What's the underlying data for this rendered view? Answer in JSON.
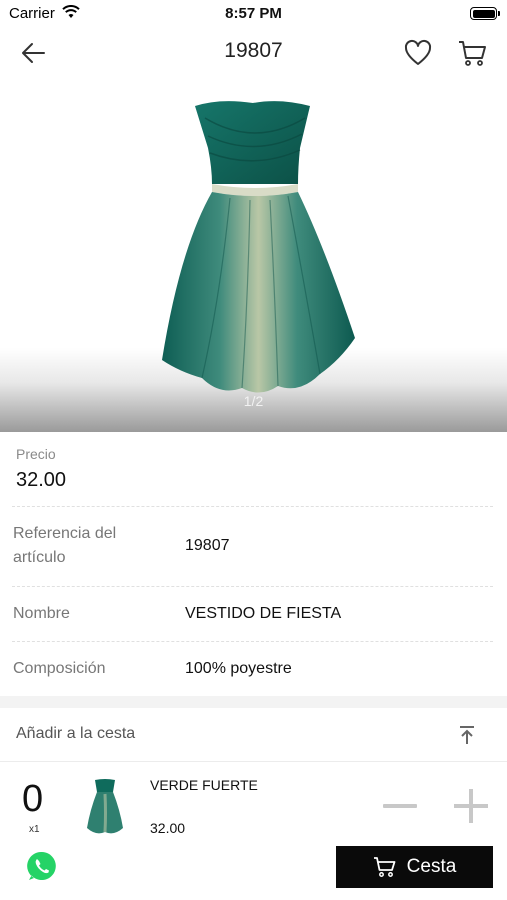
{
  "status_bar": {
    "carrier": "Carrier",
    "time": "8:57 PM"
  },
  "nav": {
    "title": "19807"
  },
  "gallery": {
    "pager": "1/2"
  },
  "details": {
    "price_label": "Precio",
    "price_value": "32.00",
    "rows": [
      {
        "label": "Referencia del artículo",
        "value": "19807"
      },
      {
        "label": "Nombre",
        "value": "VESTIDO DE  FIESTA"
      },
      {
        "label": "Composición",
        "value": "100% poyestre"
      }
    ]
  },
  "basket": {
    "header": "Añadir a la cesta",
    "item": {
      "quantity": "0",
      "multiplier": "x1",
      "color": "VERDE FUERTE",
      "price": "32.00"
    }
  },
  "footer": {
    "cesta_label": "Cesta"
  },
  "colors": {
    "accent": "#0a0a0a",
    "whatsapp": "#25d366",
    "dress": "#0f6b5c"
  },
  "icons": [
    "back-arrow-icon",
    "heart-icon",
    "cart-icon",
    "collapse-top-icon",
    "minus-icon",
    "plus-icon",
    "whatsapp-icon"
  ]
}
